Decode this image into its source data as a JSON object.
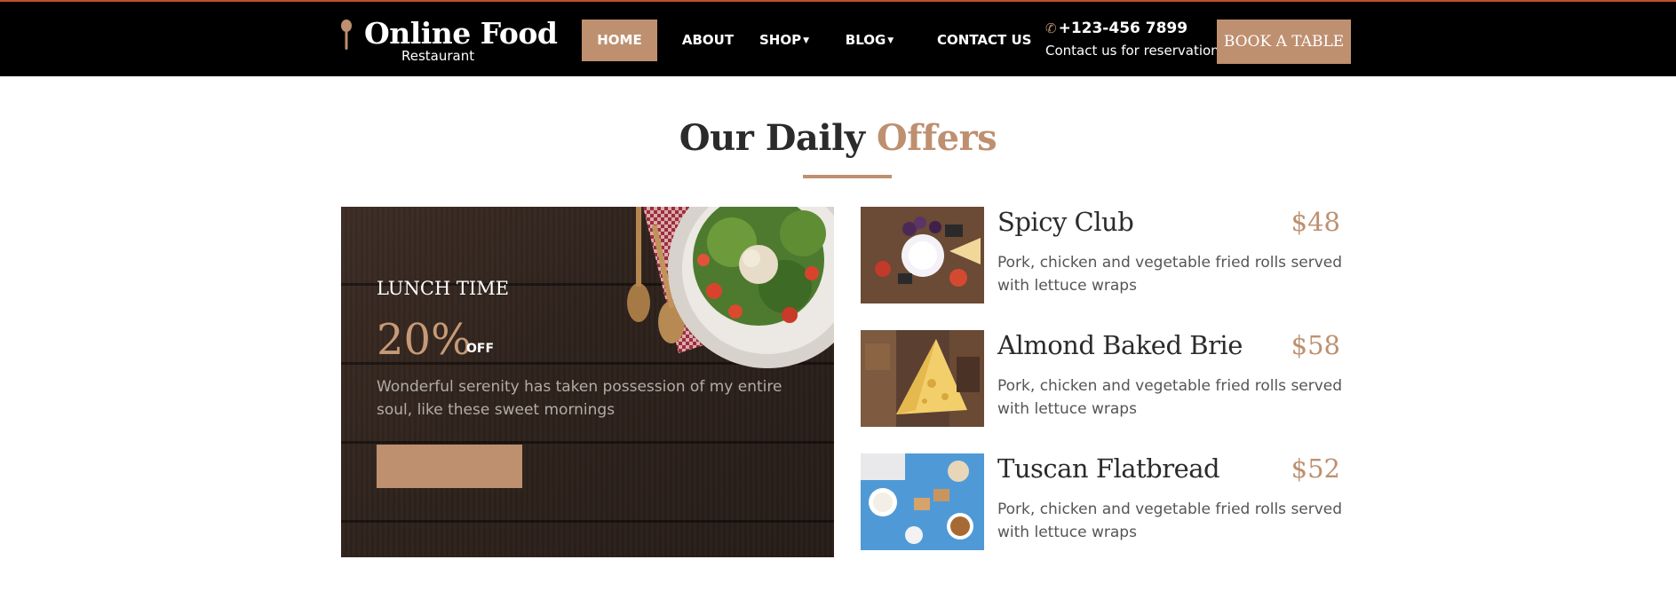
{
  "header": {
    "brand_name": "Online Food",
    "brand_sub": "Restaurant",
    "nav": [
      {
        "label": "HOME",
        "active": true
      },
      {
        "label": "ABOUT",
        "active": false
      },
      {
        "label": "SHOP",
        "active": false,
        "has_dropdown": true
      },
      {
        "label": "BLOG",
        "active": false,
        "has_dropdown": true
      },
      {
        "label": "CONTACT US",
        "active": false
      }
    ],
    "phone": "+123-456 7899",
    "contact_note": "Contact us for reservation",
    "book_label": "BOOK A TABLE"
  },
  "section": {
    "title_main": "Our Daily",
    "title_accent": "Offers"
  },
  "promo": {
    "heading": "LUNCH TIME",
    "discount": "20%",
    "off_label": "OFF",
    "description": "Wonderful serenity has taken possession of my entire soul, like these sweet mornings",
    "button_label": ""
  },
  "menu": [
    {
      "name": "Spicy Club",
      "price": "$48",
      "description": "Pork, chicken and vegetable fried rolls served with lettuce wraps"
    },
    {
      "name": "Almond Baked Brie",
      "price": "$58",
      "description": "Pork, chicken and vegetable fried rolls served with lettuce wraps"
    },
    {
      "name": "Tuscan Flatbread",
      "price": "$52",
      "description": "Pork, chicken and vegetable fried rolls served with lettuce wraps"
    }
  ],
  "colors": {
    "accent": "#be9070",
    "header_bg": "#000000",
    "top_border": "#c0502e"
  },
  "icons": {
    "logo": "spoon-icon",
    "phone": "phone-icon",
    "dropdown": "caret-down-icon"
  }
}
